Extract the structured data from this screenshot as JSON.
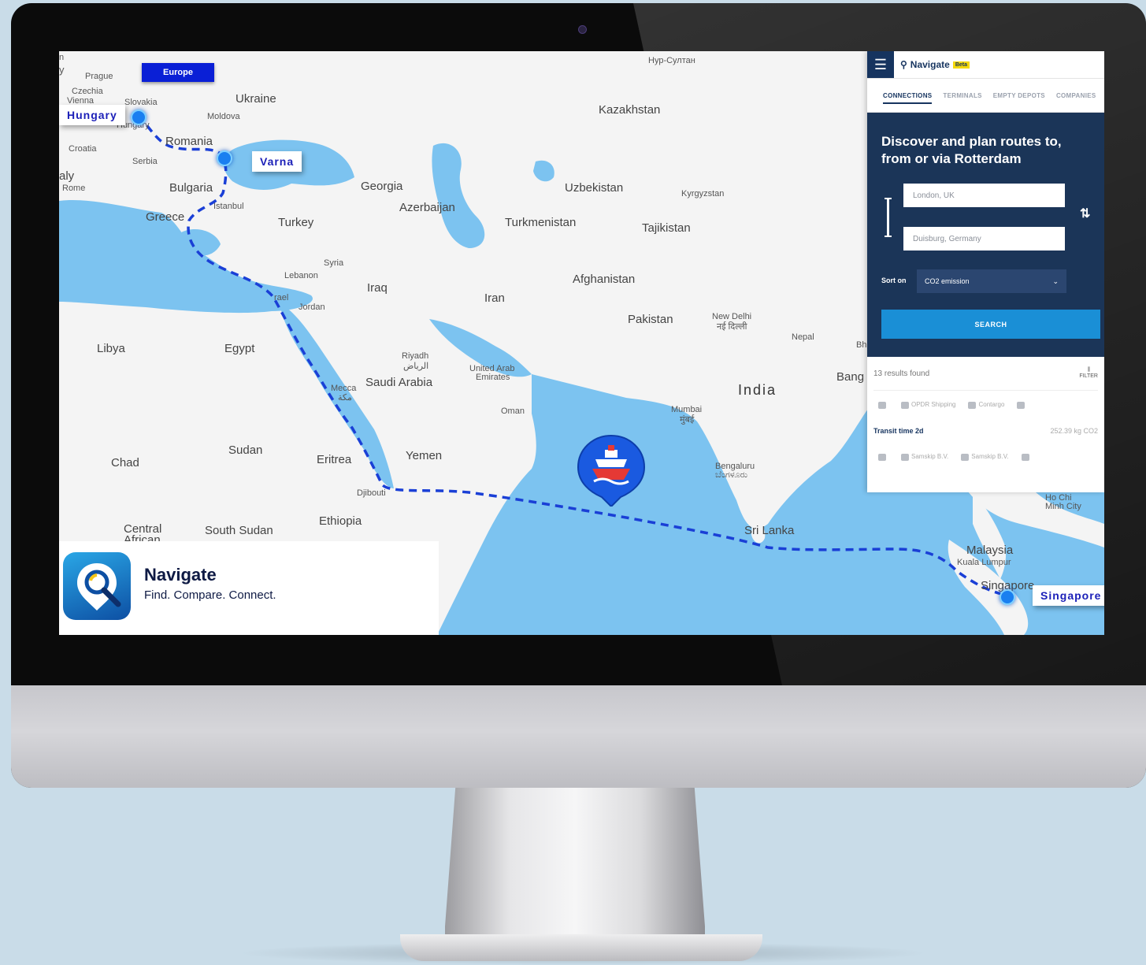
{
  "map": {
    "region_button": "Europe",
    "countries": {
      "prague": "Prague",
      "czechia": "Czechia",
      "vienna": "Vienna",
      "slovakia": "Slovakia",
      "hungary_small": "Hungary",
      "ukraine": "Ukraine",
      "moldova": "Moldova",
      "romania": "Romania",
      "croatia": "Croatia",
      "serbia": "Serbia",
      "rome": "Rome",
      "italy": "aly",
      "bulgaria": "Bulgaria",
      "istanbul": "Istanbul",
      "greece": "Greece",
      "georgia": "Georgia",
      "azerbaijan": "Azerbaijan",
      "turkey": "Turkey",
      "syria": "Syria",
      "lebanon": "Lebanon",
      "israel": "rael",
      "jordan": "Jordan",
      "iraq": "Iraq",
      "iran": "Iran",
      "kazakhstan": "Kazakhstan",
      "nur_sultan": "Нур-Султан",
      "uzbekistan": "Uzbekistan",
      "kyrgyzstan": "Kyrgyzstan",
      "turkmenistan": "Turkmenistan",
      "tajikistan": "Tajikistan",
      "afghanistan": "Afghanistan",
      "pakistan": "Pakistan",
      "new_delhi": "New Delhi",
      "new_delhi_hi": "नई दिल्ली",
      "nepal": "Nepal",
      "bh": "Bh",
      "bang": "Bang",
      "india": "India",
      "libya": "Libya",
      "egypt": "Egypt",
      "riyadh": "Riyadh",
      "riyadh_ar": "الرياض",
      "saudi": "Saudi Arabia",
      "uae": "United Arab",
      "uae2": "Emirates",
      "mecca": "Mecca",
      "mecca_ar": "مكة",
      "oman": "Oman",
      "mumbai": "Mumbai",
      "mumbai_hi": "मुंबई",
      "sudan": "Sudan",
      "chad": "Chad",
      "eritrea": "Eritrea",
      "yemen": "Yemen",
      "djibouti": "Djibouti",
      "ethiopia": "Ethiopia",
      "central_african": "Central",
      "central_african2": "African",
      "south_sudan": "South Sudan",
      "bengaluru": "Bengaluru",
      "bengaluru_kn": "ಬೆಂಗಳೂರು",
      "sri_lanka": "Sri Lanka",
      "malaysia": "Malaysia",
      "kuala_lumpur": "Kuala Lumpur",
      "singapore_small": "Singapore",
      "ho_chi": "Ho Chi",
      "minh_city": "Minh City",
      "edge_n": "n",
      "edge_y": "y"
    },
    "tags": {
      "hungary": "Hungary",
      "varna": "Varna",
      "singapore": "Singapore"
    }
  },
  "logo": {
    "title": "Navigate",
    "tagline": "Find. Compare. Connect."
  },
  "app": {
    "brand": "Navigate",
    "beta": "Beta",
    "tabs": [
      "CONNECTIONS",
      "TERMINALS",
      "EMPTY DEPOTS",
      "COMPANIES"
    ],
    "hero_title": "Discover and plan routes to, from or via Rotterdam",
    "from_placeholder": "London, UK",
    "to_placeholder": "Duisburg, Germany",
    "sort_label": "Sort on",
    "sort_value": "CO2 emission",
    "search_label": "SEARCH",
    "results_count": "13 results found",
    "filter_label": "FILTER",
    "result1": {
      "operators": [
        "OPDR Shipping",
        "Contargo"
      ]
    },
    "result2": {
      "title": "Transit time 2d",
      "co2": "252.39 kg CO2",
      "operators": [
        "Samskip B.V.",
        "Samskip B.V."
      ]
    }
  }
}
